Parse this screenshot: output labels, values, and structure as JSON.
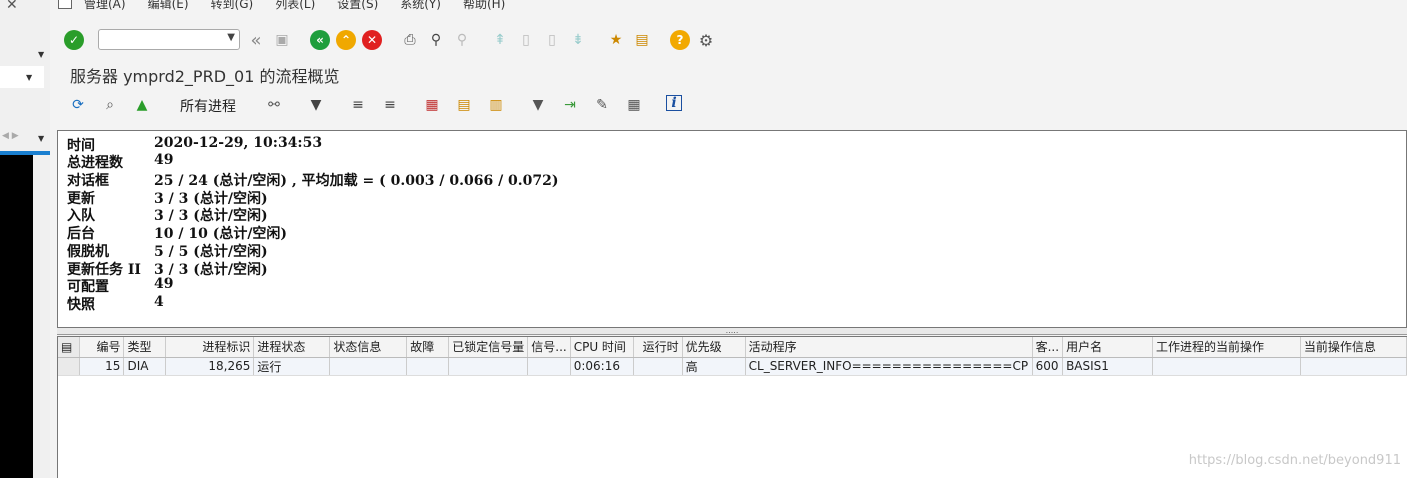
{
  "window": {
    "close_glyph": "✕"
  },
  "menu": [
    "管理(A)",
    "编辑(E)",
    "转到(G)",
    "列表(L)",
    "设置(S)",
    "系统(Y)",
    "帮助(H)"
  ],
  "title": "服务器 ymprd2_PRD_01 的流程概览",
  "appbar": {
    "all_processes": "所有进程"
  },
  "info": [
    {
      "label": "时间",
      "value": "2020-12-29, 10:34:53"
    },
    {
      "label": "总进程数",
      "value": "49"
    },
    {
      "label": "对话框",
      "value": "25 / 24  (总计/空闲) , 平均加载 = ( 0.003 / 0.066 / 0.072)"
    },
    {
      "label": "更新",
      "value": "3 / 3  (总计/空闲)"
    },
    {
      "label": "入队",
      "value": "3 / 3  (总计/空闲)"
    },
    {
      "label": "后台",
      "value": "10 / 10  (总计/空闲)"
    },
    {
      "label": "假脱机",
      "value": "5 / 5  (总计/空闲)"
    },
    {
      "label": "更新任务 II",
      "value": "3 / 3  (总计/空闲)"
    },
    {
      "label": "可配置",
      "value": "49"
    },
    {
      "label": "快照",
      "value": "4"
    }
  ],
  "grid": {
    "columns": [
      "编号",
      "类型",
      "进程标识",
      "进程状态",
      "状态信息",
      "故障",
      "已锁定信号量",
      "信号...",
      "CPU 时间",
      "运行时",
      "优先级",
      "活动程序",
      "客...",
      "用户名",
      "工作进程的当前操作",
      "当前操作信息"
    ],
    "rows": [
      [
        "15",
        "DIA",
        "18,265",
        "运行",
        "",
        "",
        "",
        "",
        "0:06:16",
        "",
        "高",
        "CL_SERVER_INFO================CP",
        "600",
        "BASIS1",
        "",
        ""
      ]
    ]
  },
  "watermark": "https://blog.csdn.net/beyond911",
  "colors": {
    "ok_green": "#2a9d2a",
    "nav_green": "#1e9e3c",
    "nav_orange": "#f0a800",
    "cancel_red": "#e02020",
    "help_yellow": "#f2a900",
    "accent_blue": "#1a7fd0"
  }
}
